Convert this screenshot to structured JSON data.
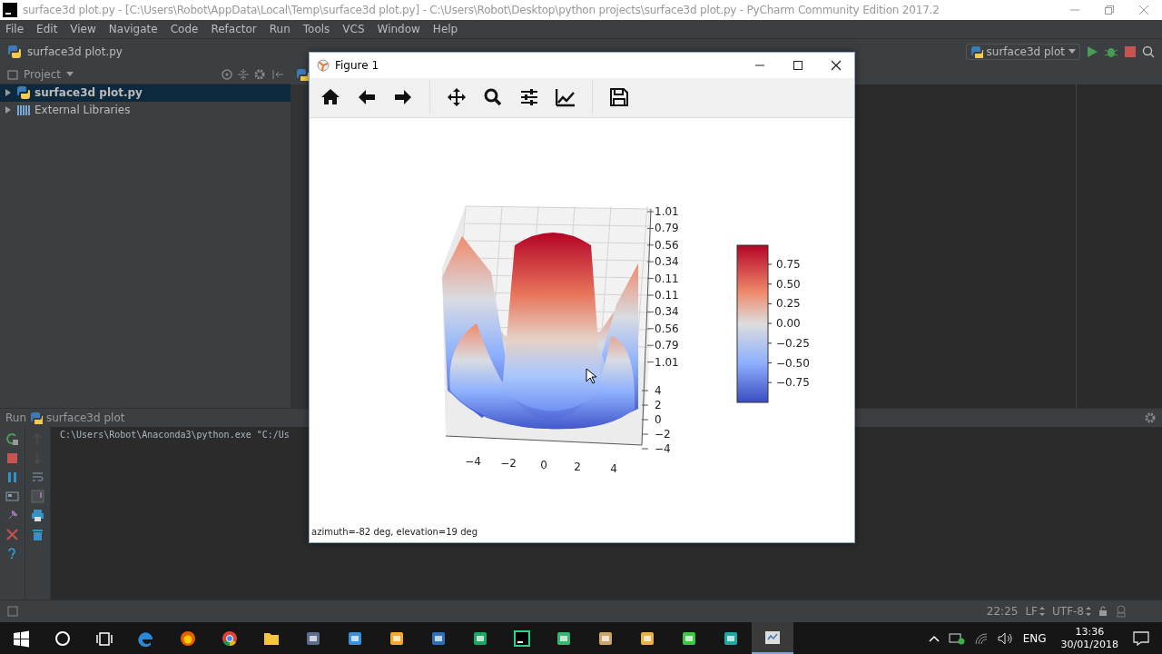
{
  "ide": {
    "title": "surface3d plot.py - [C:\\Users\\Robot\\AppData\\Local\\Temp\\surface3d plot.py] - C:\\Users\\Robot\\Desktop\\python projects\\surface3d plot.py - PyCharm Community Edition 2017.2",
    "menu": [
      "File",
      "Edit",
      "View",
      "Navigate",
      "Code",
      "Refactor",
      "Run",
      "Tools",
      "VCS",
      "Window",
      "Help"
    ],
    "breadcrumb": "surface3d plot.py",
    "run_config": "surface3d plot",
    "project_label": "Project",
    "tree": [
      {
        "label": "surface3d plot.py",
        "kind": "file",
        "selected": true
      },
      {
        "label": "External Libraries",
        "kind": "library",
        "selected": false
      }
    ],
    "run_panel": {
      "label": "Run",
      "config": "surface3d plot",
      "console": "C:\\Users\\Robot\\Anaconda3\\python.exe \"C:/Us"
    },
    "status_bar": {
      "position": "22:25",
      "line_sep": "LF",
      "encoding": "UTF-8"
    }
  },
  "figure": {
    "title": "Figure 1",
    "z_ticks": [
      "1.01",
      "0.79",
      "0.56",
      "0.34",
      "0.11",
      "0.11",
      "0.34",
      "0.56",
      "0.79",
      "1.01"
    ],
    "y_ticks": [
      "4",
      "2",
      "0",
      "−2",
      "−4"
    ],
    "x_ticks": [
      "−4",
      "−2",
      "0",
      "2",
      "4"
    ],
    "colorbar_ticks": [
      "0.75",
      "0.50",
      "0.25",
      "0.00",
      "−0.25",
      "−0.50",
      "−0.75"
    ],
    "status": "azimuth=-82 deg, elevation=19 deg"
  },
  "taskbar": {
    "apps": [
      {
        "kind": "start",
        "selected": false
      },
      {
        "kind": "search",
        "selected": false
      },
      {
        "kind": "taskview",
        "selected": false
      },
      {
        "kind": "edge",
        "selected": false
      },
      {
        "kind": "firefox",
        "selected": false
      },
      {
        "kind": "chrome",
        "selected": false
      },
      {
        "kind": "folder",
        "selected": false
      },
      {
        "kind": "app",
        "selected": false
      },
      {
        "kind": "app",
        "selected": false
      },
      {
        "kind": "app",
        "selected": false
      },
      {
        "kind": "app",
        "selected": false
      },
      {
        "kind": "app",
        "selected": false
      },
      {
        "kind": "pycharm",
        "selected": false
      },
      {
        "kind": "app",
        "selected": false
      },
      {
        "kind": "app",
        "selected": false
      },
      {
        "kind": "app",
        "selected": false
      },
      {
        "kind": "app",
        "selected": false
      },
      {
        "kind": "app",
        "selected": false
      },
      {
        "kind": "python",
        "selected": true
      }
    ],
    "language": "ENG",
    "time": "13:36",
    "date": "30/01/2018"
  }
}
